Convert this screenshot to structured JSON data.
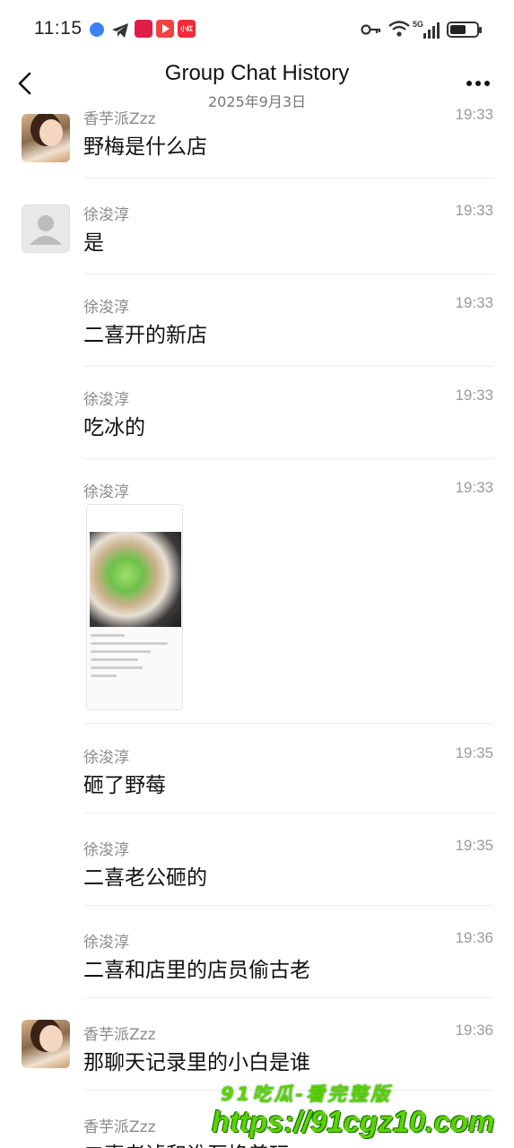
{
  "status_bar": {
    "time": "11:15",
    "network": "5G",
    "icons": [
      "app-icon-blue-circle",
      "telegram-icon",
      "app-icon-red",
      "video-app-icon",
      "xiaohongshu-icon",
      "key-icon",
      "wifi-icon",
      "signal-icon",
      "battery-icon"
    ],
    "badge_text": "小红书",
    "battery_level": 0.6
  },
  "header": {
    "title": "Group Chat History",
    "date": "2025年9月3日"
  },
  "messages": [
    {
      "sender": "香芋派Zzz",
      "time": "19:33",
      "text": "野梅是什么店",
      "avatar": "photo"
    },
    {
      "sender": "徐浚淳",
      "time": "19:33",
      "text": "是",
      "avatar": "default"
    },
    {
      "sender": "徐浚淳",
      "time": "19:33",
      "text": "二喜开的新店",
      "avatar": "none"
    },
    {
      "sender": "徐浚淳",
      "time": "19:33",
      "text": "吃冰的",
      "avatar": "none"
    },
    {
      "sender": "徐浚淳",
      "time": "19:33",
      "text": "",
      "avatar": "none",
      "type": "image"
    },
    {
      "sender": "徐浚淳",
      "time": "19:35",
      "text": "砸了野莓",
      "avatar": "none"
    },
    {
      "sender": "徐浚淳",
      "time": "19:35",
      "text": "二喜老公砸的",
      "avatar": "none"
    },
    {
      "sender": "徐浚淳",
      "time": "19:36",
      "text": "二喜和店里的店员偷古老",
      "avatar": "none"
    },
    {
      "sender": "香芋派Zzz",
      "time": "19:36",
      "text": "那聊天记录里的小白是谁",
      "avatar": "photo"
    },
    {
      "sender": "香芋派Zzz",
      "time": "19:3",
      "text": "二喜老滤和谁互换着玩",
      "avatar": "none"
    }
  ],
  "watermark": {
    "line1": "91吃瓜-看完整版",
    "line2": "https://91cgz10.com"
  }
}
